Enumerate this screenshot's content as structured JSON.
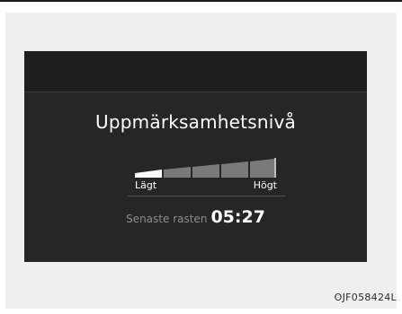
{
  "screen": {
    "title": "Uppmärksamhetsnivå",
    "level": {
      "value_fraction": 0.2,
      "segments_total": 5,
      "segments_filled": 1,
      "low_label": "Lägt",
      "high_label": "Högt"
    },
    "last_break": {
      "label": "Senaste rasten",
      "time": "05:27"
    }
  },
  "figure_code": "OJF058424L",
  "colors": {
    "screen_bg": "#262626",
    "filled_segment": "#ffffff",
    "empty_segment": "#7a7a7a",
    "muted_text": "#8c8c8c"
  }
}
